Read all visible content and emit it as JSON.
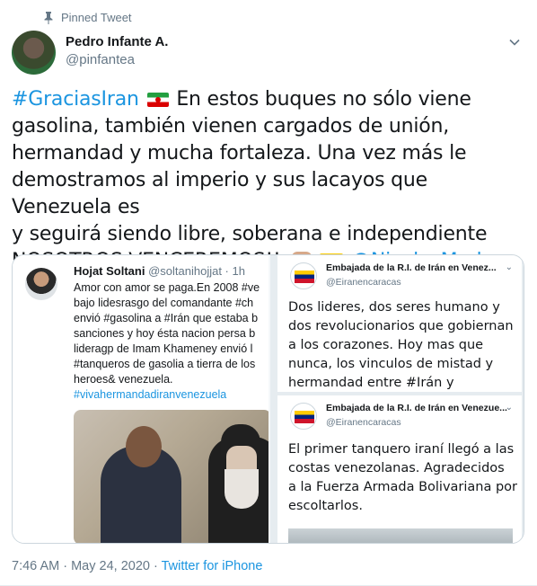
{
  "pinned": {
    "label": "Pinned Tweet",
    "icon": "pin-icon"
  },
  "author": {
    "name": "Pedro Infante A.",
    "handle": "@pinfantea"
  },
  "tweet": {
    "hashtag": "#GraciasIran",
    "line1": "En estos buques no sólo viene",
    "line2": "gasolina, también vienen cargados de unión,",
    "line3": "hermandad y mucha fortaleza. Una vez más le",
    "line4": "demostramos al imperio y sus lacayos que Venezuela es",
    "line5": "y seguirá siendo libre, soberana e independiente",
    "line6": "NOSOTROS VENCEREMOS!!",
    "mention": "@NicolasMaduro"
  },
  "media": {
    "left": {
      "name": "Hojat Soltani",
      "meta": "@soltanihojjat · 1h",
      "lines": [
        "Amor con amor se paga.En 2008 #ve",
        "bajo lidesrasgo del comandante #ch",
        "envió #gasolina a #Irán que estaba b",
        "sanciones y hoy ésta nacion persa b",
        "lideragp de Imam Khameney envió l",
        "#tanqueros de gasolia a tierra de los",
        "heroes& venezuela.",
        "#vivahermandadiranvenezuela"
      ]
    },
    "right_top": {
      "name": "Embajada de la R.I. de Irán en Venez...",
      "handle": "@Eiranencaracas",
      "lines": [
        "Dos lideres, dos seres humano y",
        "dos revolucionarios que gobiernan",
        "a los corazones.  Hoy mas que",
        "nunca, los vinculos de mistad y",
        "hermandad entre #Irán y"
      ]
    },
    "right_bottom": {
      "name": "Embajada de la R.I. de Irán en Venezue...",
      "handle": "@Eiranencaracas",
      "lines": [
        "El primer tanquero iraní llegó a las",
        "costas venezolanas. Agradecidos",
        "a la Fuerza Armada Bolivariana por",
        "escoltarlos."
      ]
    }
  },
  "footer": {
    "time": "7:46 AM · May 24, 2020 · ",
    "source": "Twitter for iPhone"
  },
  "colors": {
    "link": "#1b95e0",
    "muted": "#657786",
    "text": "#14171a"
  }
}
